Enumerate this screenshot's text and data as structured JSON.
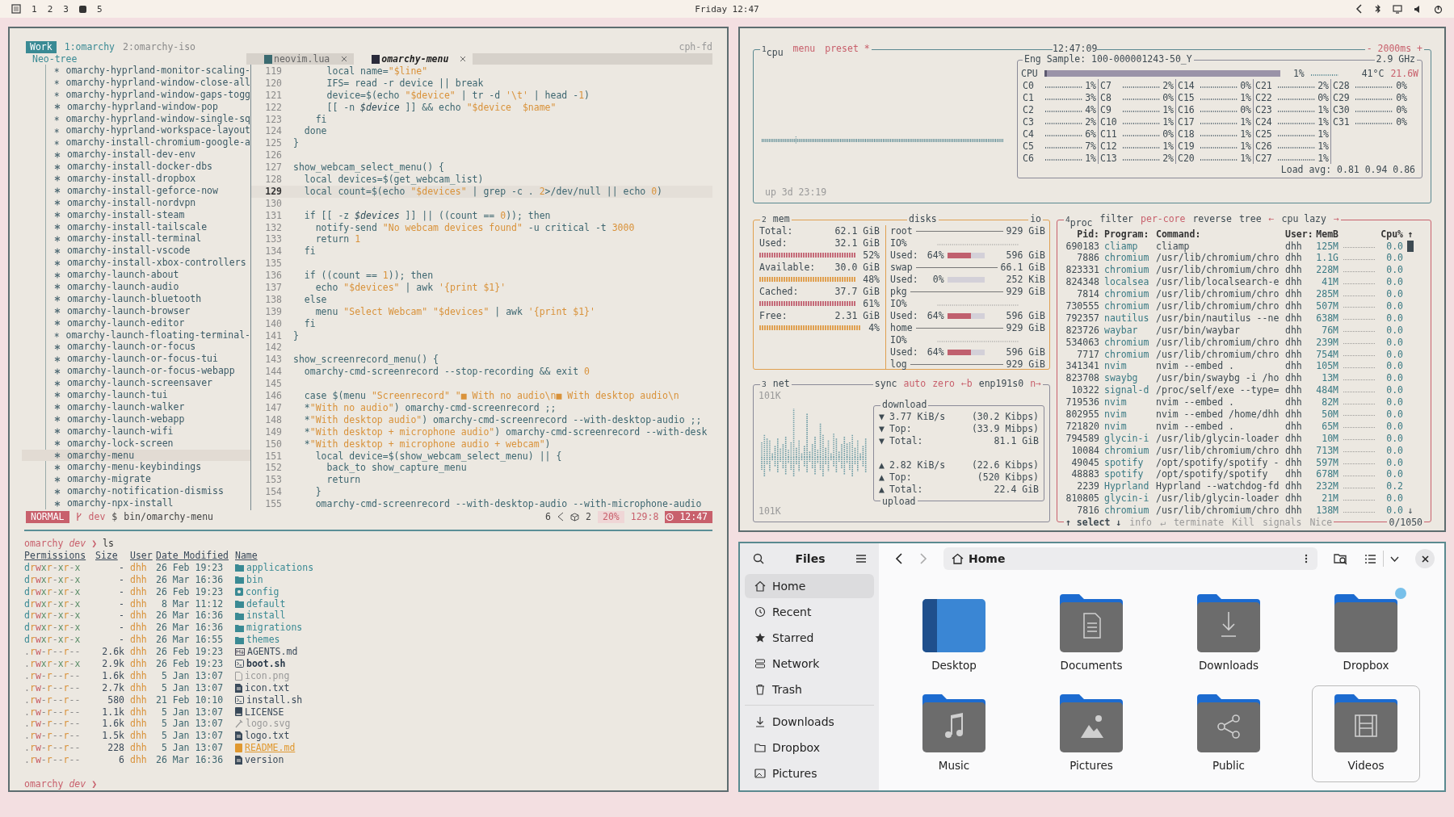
{
  "topbar": {
    "workspaces": [
      {
        "label": "1",
        "selected": false
      },
      {
        "label": "2",
        "selected": false
      },
      {
        "label": "3",
        "selected": false
      },
      {
        "selected": true
      },
      {
        "label": "5",
        "selected": false
      }
    ],
    "clock": "Friday 12:47"
  },
  "editor": {
    "session": "Work",
    "windows": [
      {
        "label": "1:omarchy",
        "selected": true
      },
      {
        "label": "2:omarchy-iso",
        "selected": false
      }
    ],
    "host": "cph-fd",
    "tree_title": "Neo-tree",
    "tabs": [
      {
        "label": "neovim.lua",
        "selected": false
      },
      {
        "label": "omarchy-menu",
        "selected": true
      }
    ],
    "tree": [
      {
        "name": "omarchy-hyprland-monitor-scaling-",
        "selected": false
      },
      {
        "name": "omarchy-hyprland-window-close-all",
        "selected": false
      },
      {
        "name": "omarchy-hyprland-window-gaps-togg",
        "selected": false
      },
      {
        "name": "omarchy-hyprland-window-pop",
        "selected": false
      },
      {
        "name": "omarchy-hyprland-window-single-sq",
        "selected": false
      },
      {
        "name": "omarchy-hyprland-workspace-layout",
        "selected": false
      },
      {
        "name": "omarchy-install-chromium-google-a",
        "selected": false
      },
      {
        "name": "omarchy-install-dev-env",
        "selected": false
      },
      {
        "name": "omarchy-install-docker-dbs",
        "selected": false
      },
      {
        "name": "omarchy-install-dropbox",
        "selected": false
      },
      {
        "name": "omarchy-install-geforce-now",
        "selected": false
      },
      {
        "name": "omarchy-install-nordvpn",
        "selected": false
      },
      {
        "name": "omarchy-install-steam",
        "selected": false
      },
      {
        "name": "omarchy-install-tailscale",
        "selected": false
      },
      {
        "name": "omarchy-install-terminal",
        "selected": false
      },
      {
        "name": "omarchy-install-vscode",
        "selected": false
      },
      {
        "name": "omarchy-install-xbox-controllers",
        "selected": false
      },
      {
        "name": "omarchy-launch-about",
        "selected": false
      },
      {
        "name": "omarchy-launch-audio",
        "selected": false
      },
      {
        "name": "omarchy-launch-bluetooth",
        "selected": false
      },
      {
        "name": "omarchy-launch-browser",
        "selected": false
      },
      {
        "name": "omarchy-launch-editor",
        "selected": false
      },
      {
        "name": "omarchy-launch-floating-terminal-",
        "selected": false
      },
      {
        "name": "omarchy-launch-or-focus",
        "selected": false
      },
      {
        "name": "omarchy-launch-or-focus-tui",
        "selected": false
      },
      {
        "name": "omarchy-launch-or-focus-webapp",
        "selected": false
      },
      {
        "name": "omarchy-launch-screensaver",
        "selected": false
      },
      {
        "name": "omarchy-launch-tui",
        "selected": false
      },
      {
        "name": "omarchy-launch-walker",
        "selected": false
      },
      {
        "name": "omarchy-launch-webapp",
        "selected": false
      },
      {
        "name": "omarchy-launch-wifi",
        "selected": false
      },
      {
        "name": "omarchy-lock-screen",
        "selected": false
      },
      {
        "name": "omarchy-menu",
        "selected": true
      },
      {
        "name": "omarchy-menu-keybindings",
        "selected": false
      },
      {
        "name": "omarchy-migrate",
        "selected": false
      },
      {
        "name": "omarchy-notification-dismiss",
        "selected": false
      },
      {
        "name": "omarchy-npx-install",
        "selected": false
      }
    ],
    "code": [
      {
        "n": "119",
        "text": "      local name=\"$line\"",
        "current": false
      },
      {
        "n": "120",
        "text": "      IFS= read -r device || break",
        "current": false
      },
      {
        "n": "121",
        "text": "      device=$(echo \"$device\" | tr -d '\\t' | head -1)",
        "current": false
      },
      {
        "n": "122",
        "text": "      [[ -n $device ]] && echo \"$device  $name\"",
        "current": false
      },
      {
        "n": "123",
        "text": "    fi",
        "current": false
      },
      {
        "n": "124",
        "text": "  done",
        "current": false
      },
      {
        "n": "125",
        "text": "}",
        "current": false
      },
      {
        "n": "126",
        "current": false
      },
      {
        "n": "127",
        "text": "show_webcam_select_menu() {",
        "current": false
      },
      {
        "n": "128",
        "text": "  local devices=$(get_webcam_list)",
        "current": false
      },
      {
        "n": "129",
        "text": "  local count=$(echo \"$devices\" | grep -c . 2>/dev/null || echo 0)",
        "current": true
      },
      {
        "n": "130",
        "current": false
      },
      {
        "n": "131",
        "text": "  if [[ -z $devices ]] || ((count == 0)); then",
        "current": false
      },
      {
        "n": "132",
        "text": "    notify-send \"No webcam devices found\" -u critical -t 3000",
        "current": false
      },
      {
        "n": "133",
        "text": "    return 1",
        "current": false
      },
      {
        "n": "134",
        "text": "  fi",
        "current": false
      },
      {
        "n": "135",
        "current": false
      },
      {
        "n": "136",
        "text": "  if ((count == 1)); then",
        "current": false
      },
      {
        "n": "137",
        "text": "    echo \"$devices\" | awk '{print $1}'",
        "current": false
      },
      {
        "n": "138",
        "text": "  else",
        "current": false
      },
      {
        "n": "139",
        "text": "    menu \"Select Webcam\" \"$devices\" | awk '{print $1}'",
        "current": false
      },
      {
        "n": "140",
        "text": "  fi",
        "current": false
      },
      {
        "n": "141",
        "text": "}",
        "current": false
      },
      {
        "n": "142",
        "current": false
      },
      {
        "n": "143",
        "text": "show_screenrecord_menu() {",
        "current": false
      },
      {
        "n": "144",
        "text": "  omarchy-cmd-screenrecord --stop-recording && exit 0",
        "current": false
      },
      {
        "n": "145",
        "current": false
      },
      {
        "n": "146",
        "text": "  case $(menu \"Screenrecord\" \"■ With no audio\\n■ With desktop audio\\n",
        "current": false
      },
      {
        "n": "147",
        "text": "  *\"With no audio\") omarchy-cmd-screenrecord ;;",
        "current": false
      },
      {
        "n": "148",
        "text": "  *\"With desktop audio\") omarchy-cmd-screenrecord --with-desktop-audio ;;",
        "current": false
      },
      {
        "n": "149",
        "text": "  *\"With desktop + microphone audio\") omarchy-cmd-screenrecord --with-desk",
        "current": false
      },
      {
        "n": "150",
        "text": "  *\"With desktop + microphone audio + webcam\")",
        "current": false
      },
      {
        "n": "151",
        "text": "    local device=$(show_webcam_select_menu) || {",
        "current": false
      },
      {
        "n": "152",
        "text": "      back_to show_capture_menu",
        "current": false
      },
      {
        "n": "153",
        "text": "      return",
        "current": false
      },
      {
        "n": "154",
        "text": "    }",
        "current": false
      },
      {
        "n": "155",
        "text": "    omarchy-cmd-screenrecord --with-desktop-audio --with-microphone-audio",
        "current": false
      }
    ],
    "status": {
      "mode": "NORMAL",
      "branch": "dev",
      "prompt": "$",
      "file": "bin/omarchy-menu",
      "diagnostics": "6",
      "packages": "2",
      "progress": "20%",
      "position": "129:8",
      "time": "12:47"
    }
  },
  "terminal": {
    "prompts": [
      {
        "dir": "omarchy",
        "branch": "dev",
        "symbol": "❯",
        "command": "ls"
      },
      {
        "dir": "omarchy",
        "branch": "dev",
        "symbol": "❯"
      }
    ],
    "columns": [
      "Permissions",
      "Size",
      "User",
      "Date Modified",
      "Name"
    ],
    "rows": [
      {
        "perms": "drwxr-xr-x",
        "size": "-",
        "user": "dhh",
        "date": "26 Feb 19:23",
        "name": "applications",
        "kind": "dir"
      },
      {
        "perms": "drwxr-xr-x",
        "size": "-",
        "user": "dhh",
        "date": "26 Mar 16:36",
        "name": "bin",
        "kind": "dir"
      },
      {
        "perms": "drwxr-xr-x",
        "size": "-",
        "user": "dhh",
        "date": "26 Feb 19:23",
        "name": "config",
        "kind": "config"
      },
      {
        "perms": "drwxr-xr-x",
        "size": "-",
        "user": "dhh",
        "date": " 8 Mar 11:12",
        "name": "default",
        "kind": "dir"
      },
      {
        "perms": "drwxr-xr-x",
        "size": "-",
        "user": "dhh",
        "date": "26 Mar 16:36",
        "name": "install",
        "kind": "dir"
      },
      {
        "perms": "drwxr-xr-x",
        "size": "-",
        "user": "dhh",
        "date": "26 Mar 16:36",
        "name": "migrations",
        "kind": "dir"
      },
      {
        "perms": "drwxr-xr-x",
        "size": "-",
        "user": "dhh",
        "date": "26 Mar 16:55",
        "name": "themes",
        "kind": "dir"
      },
      {
        "perms": ".rw-r--r--",
        "size": "2.6k",
        "user": "dhh",
        "date": "26 Feb 19:23",
        "name": "AGENTS.md",
        "kind": "markdown"
      },
      {
        "perms": ".rwxr-xr-x",
        "size": "2.9k",
        "user": "dhh",
        "date": "26 Feb 19:23",
        "name": "boot.sh",
        "kind": "executable"
      },
      {
        "perms": ".rw-r--r--",
        "size": "1.6k",
        "user": "dhh",
        "date": " 5 Jan 13:07",
        "name": "icon.png",
        "kind": "image"
      },
      {
        "perms": ".rw-r--r--",
        "size": "2.7k",
        "user": "dhh",
        "date": " 5 Jan 13:07",
        "name": "icon.txt",
        "kind": "text"
      },
      {
        "perms": ".rw-r--r--",
        "size": "580",
        "user": "dhh",
        "date": "21 Feb 10:10",
        "name": "install.sh",
        "kind": "script"
      },
      {
        "perms": ".rw-r--r--",
        "size": "1.1k",
        "user": "dhh",
        "date": " 5 Jan 13:07",
        "name": "LICENSE",
        "kind": "license"
      },
      {
        "perms": ".rw-r--r--",
        "size": "1.6k",
        "user": "dhh",
        "date": " 5 Jan 13:07",
        "name": "logo.svg",
        "kind": "vector"
      },
      {
        "perms": ".rw-r--r--",
        "size": "1.5k",
        "user": "dhh",
        "date": " 5 Jan 13:07",
        "name": "logo.txt",
        "kind": "text"
      },
      {
        "perms": ".rw-r--r--",
        "size": "228",
        "user": "dhh",
        "date": " 5 Jan 13:07",
        "name": "README.md",
        "kind": "readme"
      },
      {
        "perms": ".rw-r--r--",
        "size": "6",
        "user": "dhh",
        "date": "26 Mar 16:36",
        "name": "version",
        "kind": "text"
      }
    ]
  },
  "btop": {
    "cpu": {
      "tabs": [
        "$^{1}$cpu",
        "menu",
        "preset *"
      ],
      "clock": "12:47:09",
      "interval": "- 2000ms +",
      "uptime": "up 3d 23:19",
      "model": "Eng Sample: 100-000001243-50_Y",
      "freq": "2.9 GHz",
      "total_label": "CPU",
      "total": "1%",
      "level": 0.01,
      "temp": "41°C",
      "power": "21.6W",
      "load": "Load avg: 0.81 0.94 0.86",
      "cores": [
        {
          "name": "C0",
          "value": "1%"
        },
        {
          "name": "C1",
          "value": "3%"
        },
        {
          "name": "C2",
          "value": "4%"
        },
        {
          "name": "C3",
          "value": "2%"
        },
        {
          "name": "C4",
          "value": "6%"
        },
        {
          "name": "C5",
          "value": "7%"
        },
        {
          "name": "C6",
          "value": "1%"
        },
        {
          "name": "C7",
          "value": "2%"
        },
        {
          "name": "C8",
          "value": "0%"
        },
        {
          "name": "C9",
          "value": "1%"
        },
        {
          "name": "C10",
          "value": "1%"
        },
        {
          "name": "C11",
          "value": "0%"
        },
        {
          "name": "C12",
          "value": "1%"
        },
        {
          "name": "C13",
          "value": "2%"
        },
        {
          "name": "C14",
          "value": "0%"
        },
        {
          "name": "C15",
          "value": "1%"
        },
        {
          "name": "C16",
          "value": "0%"
        },
        {
          "name": "C17",
          "value": "1%"
        },
        {
          "name": "C18",
          "value": "1%"
        },
        {
          "name": "C19",
          "value": "1%"
        },
        {
          "name": "C20",
          "value": "1%"
        },
        {
          "name": "C21",
          "value": "2%"
        },
        {
          "name": "C22",
          "value": "0%"
        },
        {
          "name": "C23",
          "value": "1%"
        },
        {
          "name": "C24",
          "value": "1%"
        },
        {
          "name": "C25",
          "value": "1%"
        },
        {
          "name": "C26",
          "value": "1%"
        },
        {
          "name": "C27",
          "value": "1%"
        },
        {
          "name": "C28",
          "value": "0%"
        },
        {
          "name": "C29",
          "value": "0%"
        },
        {
          "name": "C30",
          "value": "0%"
        },
        {
          "name": "C31",
          "value": "0%"
        }
      ]
    },
    "mem": {
      "title": "$^{2}$mem",
      "rows": [
        {
          "label": "Total:",
          "value": "62.1 GiB"
        },
        {
          "label": "Used:",
          "value": "32.1 GiB",
          "percent": "52%",
          "color": "#c46a78"
        },
        {
          "label": "Available:",
          "value": "30.0 GiB",
          "percent": "48%",
          "color": "#e0a050"
        },
        {
          "label": "Cached:",
          "value": "37.7 GiB",
          "percent": "61%",
          "color": "#c46a78"
        },
        {
          "label": "Free:",
          "value": "2.31 GiB",
          "percent": "4%",
          "color": "#e0a050"
        }
      ]
    },
    "disks": {
      "title": "disks",
      "io_title": "io",
      "items": [
        {
          "name": "root",
          "size": "929 GiB",
          "io": "IO%",
          "used_label": "Used:",
          "used_pct": "64%",
          "level": 0.64,
          "used": "596 GiB"
        },
        {
          "name": "swap",
          "size": "66.1 GiB",
          "used_label": "Used:",
          "used_pct": "0%",
          "used": "252 KiB"
        },
        {
          "name": "pkg",
          "size": "929 GiB",
          "io": "IO%",
          "used_label": "Used:",
          "used_pct": "64%",
          "level": 0.64,
          "used": "596 GiB"
        },
        {
          "name": "home",
          "size": "929 GiB",
          "io": "IO%",
          "used_label": "Used:",
          "used_pct": "64%",
          "level": 0.64,
          "used": "596 GiB"
        },
        {
          "name": "log",
          "size": "929 GiB"
        }
      ]
    },
    "net": {
      "title": "$^{3}$net",
      "controls": [
        "sync",
        "auto",
        "zero",
        "←b",
        "enp191s0",
        "n→"
      ],
      "scale_top": "101K",
      "scale_bottom": "101K",
      "download_title": "download",
      "upload_title": "upload",
      "download": [
        {
          "arrow": "▼",
          "label": "3.77 KiB/s",
          "value": "(30.2 Kibps)"
        },
        {
          "arrow": "▼",
          "label": "Top:",
          "value": "(33.9 Mibps)"
        },
        {
          "arrow": "▼",
          "label": "Total:",
          "value": "81.1 GiB"
        }
      ],
      "upload": [
        {
          "arrow": "▲",
          "label": "2.82 KiB/s",
          "value": "(22.6 Kibps)"
        },
        {
          "arrow": "▲",
          "label": "Top:",
          "value": "(520 Kibps)"
        },
        {
          "arrow": "▲",
          "label": "Total:",
          "value": "22.4 GiB"
        }
      ]
    },
    "proc": {
      "header": [
        "$^{4}$proc",
        "filter",
        "per-core",
        "reverse",
        "tree",
        "←",
        "cpu lazy",
        "→"
      ],
      "columns": [
        "Pid:",
        "Program:",
        "Command:",
        "User:",
        "MemB",
        "Cpu%"
      ],
      "scroll_up": "↑",
      "scroll_down": "↓",
      "rows": [
        {
          "pid": "690183",
          "program": "cliamp",
          "command": "cliamp",
          "user": "dhh",
          "mem": "125M",
          "cpu": "0.0"
        },
        {
          "pid": "7886",
          "program": "chromium",
          "command": "/usr/lib/chromium/chro",
          "user": "dhh",
          "mem": "1.1G",
          "cpu": "0.0"
        },
        {
          "pid": "823331",
          "program": "chromium",
          "command": "/usr/lib/chromium/chro",
          "user": "dhh",
          "mem": "228M",
          "cpu": "0.0"
        },
        {
          "pid": "824348",
          "program": "localsea",
          "command": "/usr/lib/localsearch-e",
          "user": "dhh",
          "mem": "41M",
          "cpu": "0.0"
        },
        {
          "pid": "7814",
          "program": "chromium",
          "command": "/usr/lib/chromium/chro",
          "user": "dhh",
          "mem": "285M",
          "cpu": "0.0"
        },
        {
          "pid": "730555",
          "program": "chromium",
          "command": "/usr/lib/chromium/chro",
          "user": "dhh",
          "mem": "507M",
          "cpu": "0.0"
        },
        {
          "pid": "792357",
          "program": "nautilus",
          "command": "/usr/bin/nautilus --ne",
          "user": "dhh",
          "mem": "638M",
          "cpu": "0.0"
        },
        {
          "pid": "823726",
          "program": "waybar",
          "command": "/usr/bin/waybar",
          "user": "dhh",
          "mem": "76M",
          "cpu": "0.0"
        },
        {
          "pid": "534063",
          "program": "chromium",
          "command": "/usr/lib/chromium/chro",
          "user": "dhh",
          "mem": "239M",
          "cpu": "0.0"
        },
        {
          "pid": "7717",
          "program": "chromium",
          "command": "/usr/lib/chromium/chro",
          "user": "dhh",
          "mem": "754M",
          "cpu": "0.0"
        },
        {
          "pid": "341341",
          "program": "nvim",
          "command": "nvim --embed .",
          "user": "dhh",
          "mem": "105M",
          "cpu": "0.0"
        },
        {
          "pid": "823708",
          "program": "swaybg",
          "command": "/usr/bin/swaybg -i /ho",
          "user": "dhh",
          "mem": "13M",
          "cpu": "0.0"
        },
        {
          "pid": "10322",
          "program": "signal-d",
          "command": "/proc/self/exe --type=",
          "user": "dhh",
          "mem": "484M",
          "cpu": "0.0"
        },
        {
          "pid": "719536",
          "program": "nvim",
          "command": "nvim --embed .",
          "user": "dhh",
          "mem": "82M",
          "cpu": "0.0"
        },
        {
          "pid": "802955",
          "program": "nvim",
          "command": "nvim --embed /home/dhh",
          "user": "dhh",
          "mem": "50M",
          "cpu": "0.0"
        },
        {
          "pid": "721820",
          "program": "nvim",
          "command": "nvim --embed .",
          "user": "dhh",
          "mem": "65M",
          "cpu": "0.0"
        },
        {
          "pid": "794589",
          "program": "glycin-i",
          "command": "/usr/lib/glycin-loader",
          "user": "dhh",
          "mem": "10M",
          "cpu": "0.0"
        },
        {
          "pid": "10084",
          "program": "chromium",
          "command": "/usr/lib/chromium/chro",
          "user": "dhh",
          "mem": "713M",
          "cpu": "0.0"
        },
        {
          "pid": "49045",
          "program": "spotify",
          "command": "/opt/spotify/spotify -",
          "user": "dhh",
          "mem": "597M",
          "cpu": "0.0"
        },
        {
          "pid": "48883",
          "program": "spotify",
          "command": "/opt/spotify/spotify",
          "user": "dhh",
          "mem": "678M",
          "cpu": "0.0"
        },
        {
          "pid": "2239",
          "program": "Hyprland",
          "command": "Hyprland --watchdog-fd",
          "user": "dhh",
          "mem": "232M",
          "cpu": "0.2"
        },
        {
          "pid": "810805",
          "program": "glycin-i",
          "command": "/usr/lib/glycin-loader",
          "user": "dhh",
          "mem": "21M",
          "cpu": "0.0"
        },
        {
          "pid": "7816",
          "program": "chromium",
          "command": "/usr/lib/chromium/chro",
          "user": "dhh",
          "mem": "138M",
          "cpu": "0.0"
        }
      ],
      "footer": [
        "↑ select ↓",
        "info",
        "↵",
        "terminate",
        "Kill",
        "signals",
        "Nice"
      ],
      "count": "0/1050"
    }
  },
  "files": {
    "title": "Files",
    "location": "Home",
    "sidebar": [
      {
        "label": "Home",
        "kind": "home",
        "selected": true
      },
      {
        "label": "Recent",
        "kind": "recent",
        "selected": false
      },
      {
        "label": "Starred",
        "kind": "star",
        "selected": false
      },
      {
        "label": "Network",
        "kind": "network",
        "selected": false
      },
      {
        "label": "Trash",
        "kind": "trash",
        "selected": false
      },
      {
        "label": "Downloads",
        "kind": "download",
        "selected": false,
        "section": true
      },
      {
        "label": "Dropbox",
        "kind": "folder",
        "selected": false
      },
      {
        "label": "Pictures",
        "kind": "picture",
        "selected": false
      }
    ],
    "folders": [
      {
        "label": "Desktop",
        "kind": "desktop",
        "selected": false
      },
      {
        "label": "Documents",
        "kind": "documents",
        "selected": false
      },
      {
        "label": "Downloads",
        "kind": "downloads",
        "selected": false
      },
      {
        "label": "Dropbox",
        "kind": "plain",
        "selected": false,
        "synced": true
      },
      {
        "label": "Music",
        "kind": "music",
        "selected": false
      },
      {
        "label": "Pictures",
        "kind": "pictures",
        "selected": false
      },
      {
        "label": "Public",
        "kind": "public",
        "selected": false
      },
      {
        "label": "Videos",
        "kind": "videos",
        "selected": true
      }
    ]
  }
}
